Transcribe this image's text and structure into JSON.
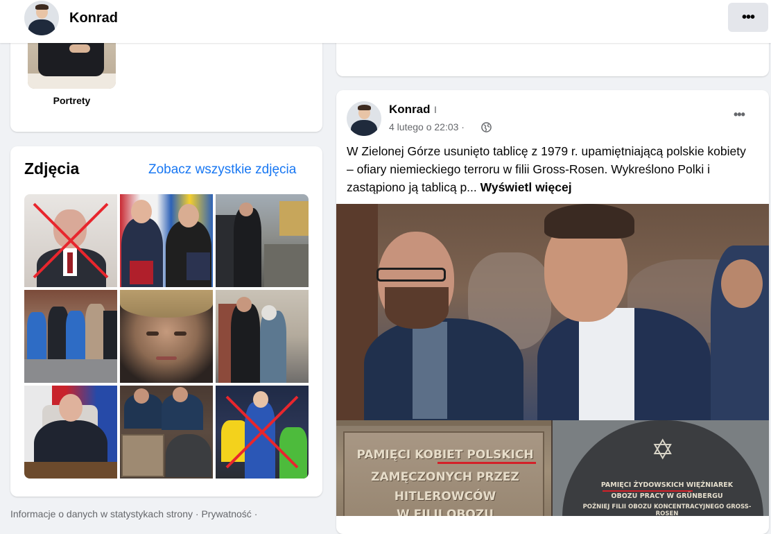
{
  "header": {
    "name": "Konrad",
    "more_icon": "more-horizontal-icon",
    "more_label": "•••"
  },
  "intro_card": {
    "portrait_label": "Portrety"
  },
  "photos": {
    "title": "Zdjęcia",
    "see_all": "Zobacz wszystkie zdjęcia",
    "tiles": [
      {
        "desc": "portrait-crossed-out",
        "crossed": true
      },
      {
        "desc": "handshake-flags",
        "crossed": false
      },
      {
        "desc": "street-visit",
        "crossed": false
      },
      {
        "desc": "crowd-walk",
        "crossed": false
      },
      {
        "desc": "woman-portrait",
        "crossed": false
      },
      {
        "desc": "meeting-outdoors",
        "crossed": false
      },
      {
        "desc": "press-conference",
        "crossed": false
      },
      {
        "desc": "audience-plaques",
        "crossed": false
      },
      {
        "desc": "athlete-crossed-out",
        "crossed": true
      }
    ]
  },
  "footer": {
    "text": "Informacje o danych w statystykach strony · Prywatność ·"
  },
  "post": {
    "author": "Konrad",
    "separator": "I",
    "date": "4 lutego o 22:03 ·",
    "privacy_icon": "globe-icon",
    "options_label": "•••",
    "text": "W Zielonej Górze usunięto tablicę z 1979 r. upamiętniającą polskie kobiety – ofiary niemieckiego terroru w filii Gross-Rosen. Wykreślono Polki i zastąpiono ją tablicą p...",
    "see_more": "Wyświetl więcej",
    "plaque_left": [
      "PAMIĘCI KOBIET POLSKICH",
      "ZAMĘCZONYCH PRZEZ",
      "HITLEROWCÓW",
      "W FILII OBOZU"
    ],
    "plaque_right": [
      "PAMIĘCI ŻYDOWSKICH WIĘŹNIAREK",
      "OBOZU PRACY W GRÜNBERGU",
      "POŹNIEJ FILII OBOZU KONCENTRACYJNEGO GROSS-ROSEN"
    ],
    "star_glyph": "✡"
  },
  "colors": {
    "link": "#1877f2",
    "background": "#f0f2f5",
    "secondary_text": "#65676b"
  }
}
